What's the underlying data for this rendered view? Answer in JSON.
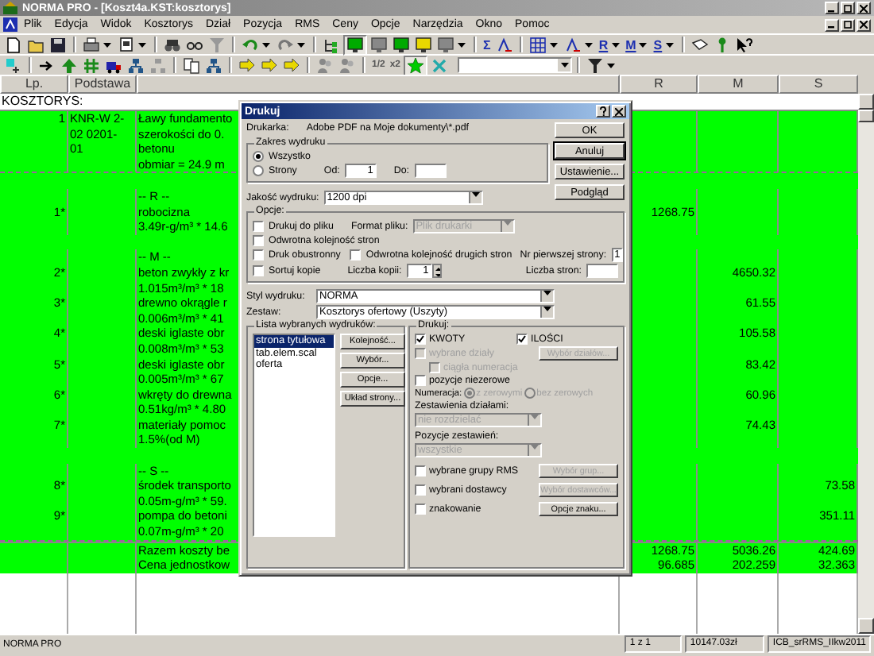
{
  "window": {
    "title": "NORMA PRO - [Koszt4a.KST:kosztorys]"
  },
  "menu": [
    "Plik",
    "Edycja",
    "Widok",
    "Kosztorys",
    "Dział",
    "Pozycja",
    "RMS",
    "Ceny",
    "Opcje",
    "Narzędzia",
    "Okno",
    "Pomoc"
  ],
  "toolbar_texts": {
    "sum": "Σ",
    "r": "R",
    "m": "M",
    "s": "S",
    "half": "1/2",
    "double": "x2"
  },
  "table": {
    "columns": [
      "Lp.",
      "Podstawa",
      "R",
      "M",
      "S"
    ],
    "section": "KOSZTORYS:",
    "blocks": [
      {
        "lines": [
          {
            "lp": "1",
            "podstawa": "KNR-W 2-",
            "opis": "Ławy fundamento"
          },
          {
            "podstawa": "02 0201-",
            "opis": "szerokości do 0."
          },
          {
            "podstawa": "01",
            "opis": "betonu"
          },
          {
            "opis": "obmiar  = 24.9 m"
          }
        ]
      },
      {
        "lines": [
          {
            "opis": "-- R --",
            "gap_before": true
          },
          {
            "lp": "1*",
            "opis": "robocizna",
            "r": "1268.75"
          },
          {
            "opis": "3.49r-g/m³ * 14.6"
          },
          {
            "opis": "-- M --",
            "gap_before": true
          },
          {
            "lp": "2*",
            "opis": "beton zwykły z kr",
            "m": "4650.32"
          },
          {
            "opis": "1.015m³/m³ * 18"
          },
          {
            "lp": "3*",
            "opis": "drewno okrągle r",
            "m": "61.55"
          },
          {
            "opis": "0.006m³/m³ * 41"
          },
          {
            "lp": "4*",
            "opis": "deski iglaste obr",
            "m": "105.58"
          },
          {
            "opis": "0.008m³/m³ * 53"
          },
          {
            "lp": "5*",
            "opis": "deski iglaste obr",
            "m": "83.42"
          },
          {
            "opis": "0.005m³/m³ * 67"
          },
          {
            "lp": "6*",
            "opis": "wkręty do drewna",
            "m": "60.96"
          },
          {
            "opis": "0.51kg/m³ * 4.80"
          },
          {
            "lp": "7*",
            "opis": "materiały pomoc",
            "m": "74.43"
          },
          {
            "opis": "1.5%(od M)"
          },
          {
            "opis": "-- S --",
            "gap_before": true
          },
          {
            "lp": "8*",
            "opis": "środek transporto",
            "s": "73.58"
          },
          {
            "opis": "0.05m-g/m³ * 59."
          },
          {
            "lp": "9*",
            "opis": "pompa do betoni",
            "s": "351.11"
          },
          {
            "opis": "0.07m-g/m³ * 20"
          }
        ]
      },
      {
        "lines": [
          {
            "opis": "Razem koszty be",
            "r": "1268.75",
            "m": "5036.26",
            "s": "424.69"
          },
          {
            "opis": "Cena jednostkow",
            "r": "96.685",
            "m": "202.259",
            "s": "32.363"
          }
        ]
      }
    ]
  },
  "status_bar": {
    "app": "NORMA PRO",
    "page": "1 z 1",
    "total": "10147.03zł",
    "prices": "ICB_srRMS_IIkw2011"
  },
  "dialog": {
    "title": "Drukuj",
    "printer_label": "Drukarka:",
    "printer": "Adobe PDF na Moje dokumenty\\*.pdf",
    "buttons": [
      {
        "label": "OK",
        "focused": false
      },
      {
        "label": "Anuluj",
        "focused": true
      },
      {
        "label": "Ustawienie...",
        "focused": false
      },
      {
        "label": "Podgląd",
        "focused": false
      }
    ],
    "range": {
      "legend": "Zakres wydruku",
      "options": [
        {
          "label": "Wszystko",
          "selected": true
        },
        {
          "label": "Strony",
          "selected": false
        }
      ],
      "from_label": "Od:",
      "from": "1",
      "to_label": "Do:"
    },
    "quality": {
      "label": "Jakość wydruku:",
      "value": "1200 dpi"
    },
    "options": {
      "legend": "Opcje:",
      "print_to_file": {
        "label": "Drukuj do pliku",
        "checked": false
      },
      "file_format": {
        "label": "Format pliku:",
        "value": "Plik drukarki",
        "disabled": true
      },
      "reverse_order": {
        "label": "Odwrotna kolejność stron",
        "checked": false
      },
      "duplex": {
        "label": "Druk obustronny",
        "checked": false
      },
      "reverse_second": {
        "label": "Odwrotna kolejność drugich stron",
        "checked": false
      },
      "first_page": {
        "label": "Nr pierwszej strony:",
        "value": "1"
      },
      "collate": {
        "label": "Sortuj kopie",
        "checked": false
      },
      "copies": {
        "label": "Liczba kopii:",
        "value": "1"
      },
      "pages": {
        "label": "Liczba stron:"
      }
    },
    "style": {
      "label": "Styl wydruku:",
      "value": "NORMA"
    },
    "set": {
      "label": "Zestaw:",
      "value": "Kosztorys ofertowy (Uszyty)"
    },
    "printouts": {
      "legend": "Lista wybranych wydruków:",
      "items": [
        {
          "label": "strona tytułowa",
          "selected": true
        },
        {
          "label": "tab.elem.scal",
          "selected": false
        },
        {
          "label": "oferta",
          "selected": false
        }
      ],
      "buttons": [
        "Kolejność...",
        "Wybór...",
        "Opcje...",
        "Układ strony..."
      ]
    },
    "print": {
      "legend": "Drukuj:",
      "amounts": {
        "label": "KWOTY",
        "checked": true
      },
      "quantities": {
        "label": "ILOŚCI",
        "checked": true
      },
      "sections": {
        "label": "wybrane działy",
        "checked": false,
        "disabled": true
      },
      "sections_button": {
        "label": "Wybór działów...",
        "disabled": true
      },
      "continuous": {
        "label": "ciągła numeracja",
        "checked": false,
        "disabled": true
      },
      "nonzero": {
        "label": "pozycje niezerowe",
        "checked": false,
        "disabled": false
      },
      "numbering": {
        "label": "Numeracja:",
        "disabled": true,
        "options": [
          {
            "label": "z zerowymi",
            "selected": true
          },
          {
            "label": "bez zerowych",
            "selected": false
          }
        ]
      },
      "section_summary": {
        "label": "Zestawienia działami:",
        "value": "nie rozdzielać",
        "disabled": true
      },
      "summary_items": {
        "label": "Pozycje zestawień:",
        "value": "wszystkie",
        "disabled": true
      },
      "extra": [
        {
          "label": "wybrane grupy RMS",
          "checked": false,
          "button": {
            "label": "Wybór grup...",
            "disabled": true
          }
        },
        {
          "label": "wybrani dostawcy",
          "checked": false,
          "button": {
            "label": "Wybór dostawców...",
            "disabled": true
          }
        },
        {
          "label": "znakowanie",
          "checked": false,
          "button": {
            "label": "Opcje znaku...",
            "disabled": false
          }
        }
      ]
    }
  }
}
